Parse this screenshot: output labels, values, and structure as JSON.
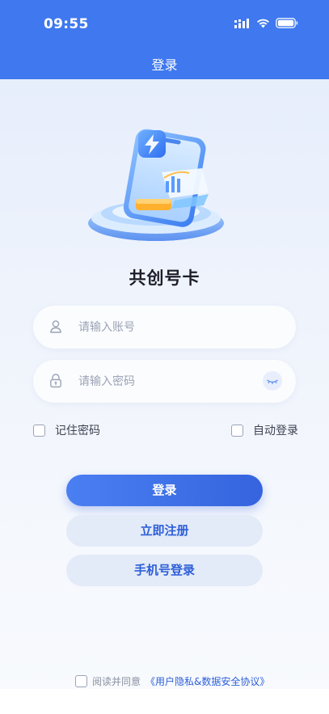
{
  "status_bar": {
    "time": "09:55"
  },
  "nav": {
    "title": "登录"
  },
  "app": {
    "name": "共创号卡"
  },
  "form": {
    "account_placeholder": "请输入账号",
    "password_placeholder": "请输入密码",
    "remember_label": "记住密码",
    "auto_login_label": "自动登录"
  },
  "buttons": {
    "login": "登录",
    "register": "立即注册",
    "phone_login": "手机号登录"
  },
  "agreement": {
    "prefix": "阅读并同意",
    "link": "《用户隐私&数据安全协议》"
  },
  "icons": {
    "user": "user-icon",
    "lock": "lock-icon",
    "eye": "eye-closed-icon",
    "signal": "signal-icon",
    "wifi": "wifi-icon",
    "battery": "battery-icon"
  },
  "colors": {
    "primary": "#3f78ef",
    "button_primary": "#3564de",
    "button_secondary_bg": "#e3eaf8",
    "link": "#2d5fd8"
  }
}
